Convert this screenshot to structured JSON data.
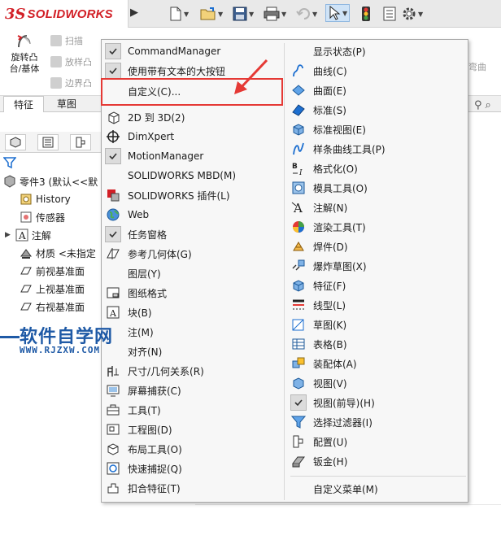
{
  "app": {
    "logo_ds": "3S",
    "logo_name": "SOLIDWORKS"
  },
  "ribbon": {
    "revolve_label_1": "旋转凸",
    "revolve_label_2": "台/基体",
    "sweep": "扫描",
    "loft": "放样凸",
    "boundary": "边界凸",
    "wrap_right": "弯曲"
  },
  "tabs": [
    {
      "label": "特征"
    },
    {
      "label": "草图"
    }
  ],
  "tree": {
    "root": "零件3 (默认<<默",
    "items": [
      {
        "label": "History",
        "icon": "history-icon"
      },
      {
        "label": "传感器",
        "icon": "sensor-icon"
      },
      {
        "label": "注解",
        "icon": "annotation-icon"
      },
      {
        "label": "材质 <未指定",
        "icon": "material-icon"
      },
      {
        "label": "前视基准面",
        "icon": "plane-icon"
      },
      {
        "label": "上视基准面",
        "icon": "plane-icon"
      },
      {
        "label": "右视基准面",
        "icon": "plane-icon"
      }
    ]
  },
  "watermark": {
    "title": "软件自学网",
    "url": "WWW.RJZXW.COM"
  },
  "menu": {
    "left": [
      {
        "label": "CommandManager",
        "checked": true
      },
      {
        "label": "使用带有文本的大按钮",
        "checked": true
      },
      {
        "label": "自定义(C)...",
        "checked": false
      },
      {
        "label": "2D 到 3D(2)",
        "icon": "2d-to-3d-icon"
      },
      {
        "label": "DimXpert",
        "icon": "dimxpert-icon"
      },
      {
        "label": "MotionManager",
        "checked": true
      },
      {
        "label": "SOLIDWORKS MBD(M)"
      },
      {
        "label": "SOLIDWORKS 插件(L)",
        "icon": "addins-icon"
      },
      {
        "label": "Web",
        "icon": "web-icon"
      },
      {
        "label": "任务窗格",
        "checked": true
      },
      {
        "label": "参考几何体(G)",
        "icon": "reference-geometry-icon"
      },
      {
        "label": "图层(Y)"
      },
      {
        "label": "图纸格式",
        "icon": "sheet-format-icon"
      },
      {
        "label": "块(B)",
        "icon": "block-icon"
      },
      {
        "label": "注(M)",
        "icon": "note-icon"
      },
      {
        "label": "对齐(N)",
        "icon": "align-icon"
      },
      {
        "label": "尺寸/几何关系(R)",
        "icon": "dimension-icon"
      },
      {
        "label": "屏幕捕获(C)",
        "icon": "screen-capture-icon"
      },
      {
        "label": "工具(T)",
        "icon": "tools-icon"
      },
      {
        "label": "工程图(D)",
        "icon": "drawing-icon"
      },
      {
        "label": "布局工具(O)",
        "icon": "layout-tools-icon"
      },
      {
        "label": "快速捕捉(Q)",
        "icon": "quick-snap-icon"
      },
      {
        "label": "扣合特征(T)",
        "icon": "fastening-feature-icon"
      }
    ],
    "right": [
      {
        "label": "显示状态(P)"
      },
      {
        "label": "曲线(C)",
        "icon": "curve-icon"
      },
      {
        "label": "曲面(E)",
        "icon": "surface-icon"
      },
      {
        "label": "标准(S)",
        "icon": "standard-icon"
      },
      {
        "label": "标准视图(E)",
        "icon": "standard-views-icon"
      },
      {
        "label": "样条曲线工具(P)",
        "icon": "spline-icon"
      },
      {
        "label": "格式化(O)",
        "icon": "format-icon"
      },
      {
        "label": "模具工具(O)",
        "icon": "mold-tools-icon"
      },
      {
        "label": "注解(N)",
        "icon": "annotation-icon"
      },
      {
        "label": "渲染工具(T)",
        "icon": "render-icon"
      },
      {
        "label": "焊件(D)",
        "icon": "weldment-icon"
      },
      {
        "label": "爆炸草图(X)",
        "icon": "explode-sketch-icon"
      },
      {
        "label": "特征(F)",
        "icon": "features-icon"
      },
      {
        "label": "线型(L)",
        "icon": "line-format-icon"
      },
      {
        "label": "草图(K)",
        "icon": "sketch-icon"
      },
      {
        "label": "表格(B)",
        "icon": "table-icon"
      },
      {
        "label": "装配体(A)",
        "icon": "assembly-icon"
      },
      {
        "label": "视图(V)",
        "icon": "view-icon"
      },
      {
        "label": "视图(前导)(H)",
        "checked": true
      },
      {
        "label": "选择过滤器(I)",
        "icon": "selection-filter-icon"
      },
      {
        "label": "配置(U)",
        "icon": "configuration-icon"
      },
      {
        "label": "钣金(H)",
        "icon": "sheet-metal-icon"
      },
      {
        "label": "自定义菜单(M)"
      }
    ]
  },
  "colors": {
    "brand": "#d21f26",
    "highlight": "#e53935",
    "watermark": "#1f5aa6"
  }
}
